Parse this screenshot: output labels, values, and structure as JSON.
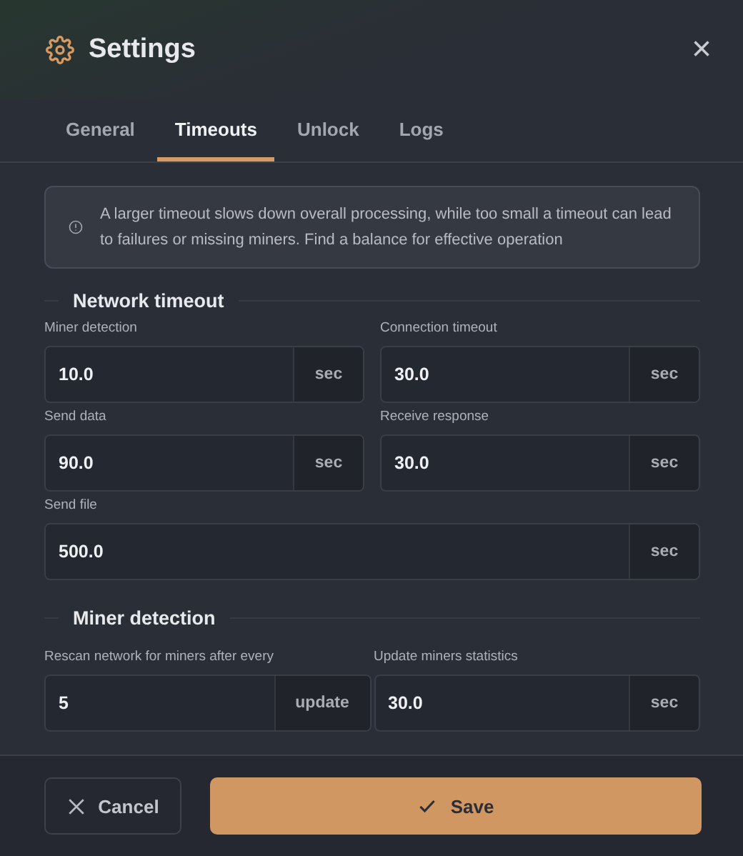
{
  "window": {
    "title": "Settings",
    "close": "×"
  },
  "tabs": [
    {
      "label": "General",
      "selected": false
    },
    {
      "label": "Timeouts",
      "selected": true
    },
    {
      "label": "Unlock",
      "selected": false
    },
    {
      "label": "Logs",
      "selected": false
    }
  ],
  "notice": "A larger timeout slows down overall processing, while too small a timeout can lead to failures or missing miners. Find a balance for effective operation",
  "sections": [
    {
      "title": "Network timeout",
      "fields": [
        {
          "label": "Miner detection",
          "value": "10.0",
          "unit": "sec",
          "kind": "half"
        },
        {
          "label": "Connection timeout",
          "value": "30.0",
          "unit": "sec",
          "kind": "half"
        },
        {
          "label": "Send data",
          "value": "90.0",
          "unit": "sec",
          "kind": "half"
        },
        {
          "label": "Receive response",
          "value": "30.0",
          "unit": "sec",
          "kind": "half"
        },
        {
          "label": "Send file",
          "value": "500.0",
          "unit": "sec",
          "kind": "wide"
        }
      ]
    },
    {
      "title": "Miner detection",
      "fields": [
        {
          "label": "Rescan network for miners after every",
          "value": "5",
          "unit": "update",
          "kind": "half"
        },
        {
          "label": "Update miners statistics",
          "value": "30.0",
          "unit": "sec",
          "kind": "half"
        }
      ]
    }
  ],
  "buttons": [
    {
      "label": "Cancel",
      "kind": "secondary"
    },
    {
      "label": "Save",
      "kind": "primary"
    }
  ]
}
